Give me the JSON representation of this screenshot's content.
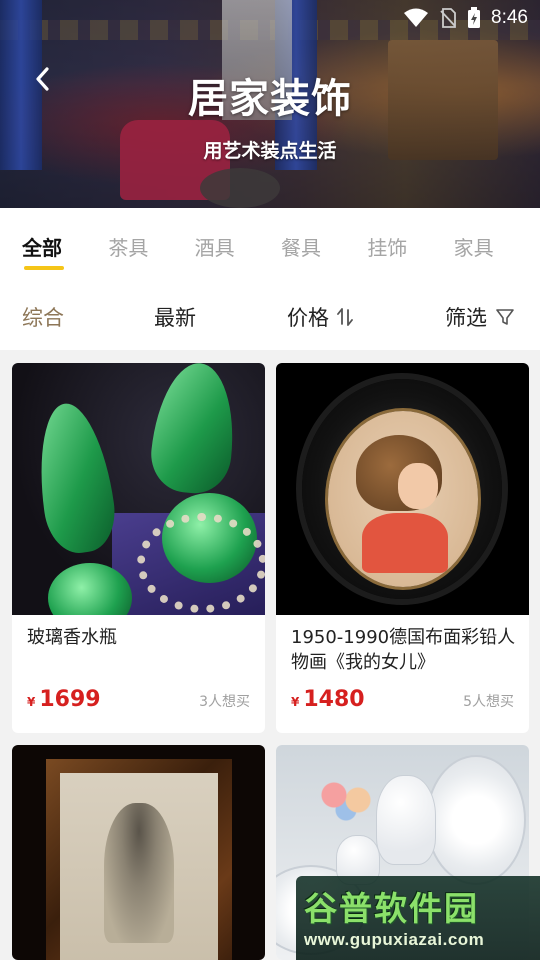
{
  "status_bar": {
    "time": "8:46",
    "wifi_icon": "wifi-icon",
    "sim_icon": "no-sim-icon",
    "battery_icon": "battery-charging-icon"
  },
  "header": {
    "title": "居家装饰",
    "subtitle": "用艺术装点生活",
    "back_icon": "chevron-left-icon"
  },
  "tabs": [
    {
      "label": "全部",
      "active": true
    },
    {
      "label": "茶具",
      "active": false
    },
    {
      "label": "酒具",
      "active": false
    },
    {
      "label": "餐具",
      "active": false
    },
    {
      "label": "挂饰",
      "active": false
    },
    {
      "label": "家具",
      "active": false
    }
  ],
  "sort_bar": {
    "comprehensive": "综合",
    "newest": "最新",
    "price": "价格",
    "price_icon": "sort-arrows-icon",
    "filter": "筛选",
    "filter_icon": "funnel-icon"
  },
  "products": [
    {
      "name": "玻璃香水瓶",
      "currency": "¥",
      "price": "1699",
      "wants": "3人想买"
    },
    {
      "name": "1950-1990德国布面彩铅人物画《我的女儿》",
      "currency": "¥",
      "price": "1480",
      "wants": "5人想买"
    },
    {
      "name": "",
      "currency": "",
      "price": "",
      "wants": ""
    },
    {
      "name": "",
      "currency": "",
      "price": "",
      "wants": ""
    }
  ],
  "watermark": {
    "logo": "谷普软件园",
    "url": "www.gupuxiazai.com"
  },
  "colors": {
    "accent": "#f5c518",
    "price_red": "#d6201f",
    "active_sort": "#8d7657"
  }
}
